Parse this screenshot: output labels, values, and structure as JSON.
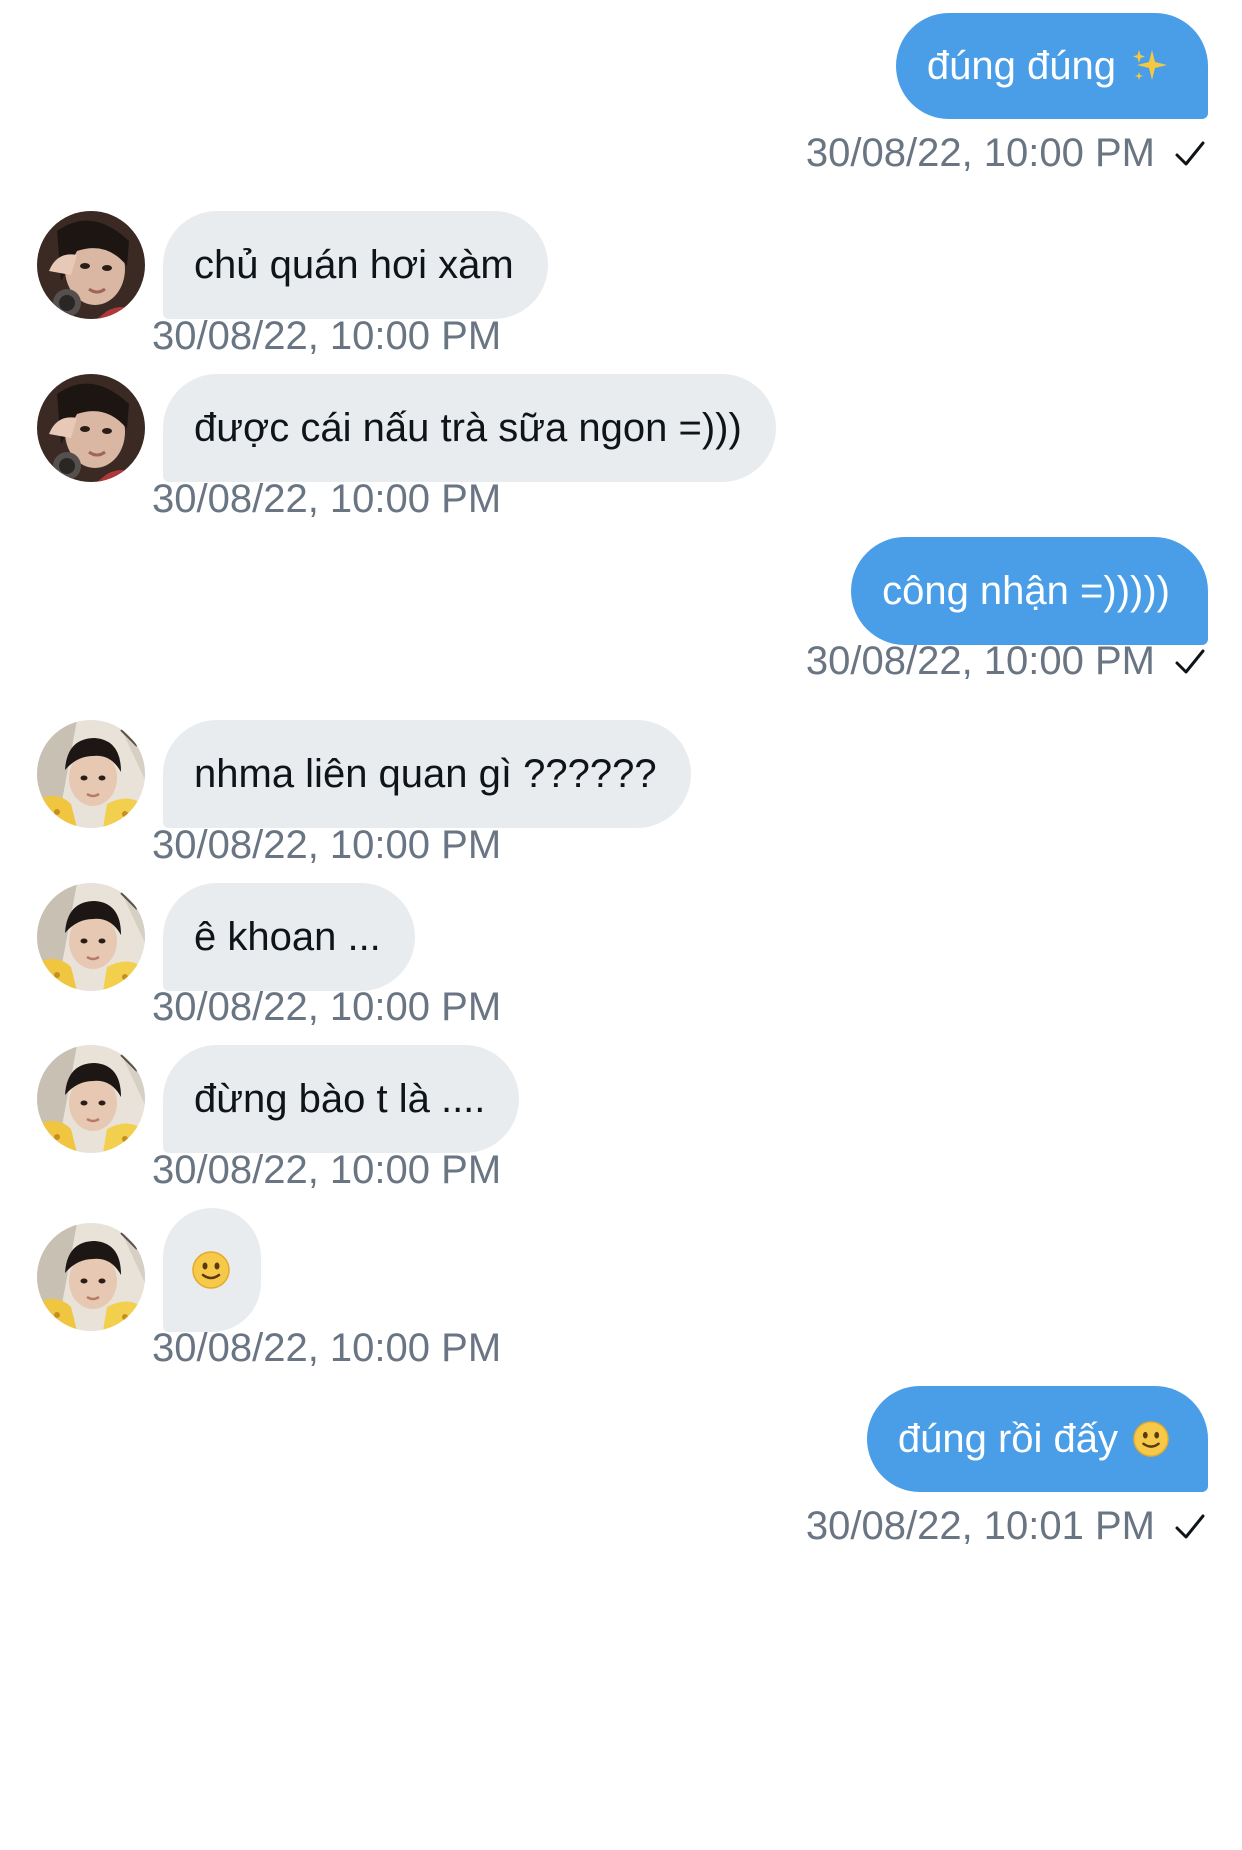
{
  "conversation": {
    "messages": [
      {
        "text": "đúng đúng",
        "time": "30/08/22, 10:00 PM"
      },
      {
        "text": "chủ quán hơi xàm",
        "time": "30/08/22, 10:00 PM"
      },
      {
        "text": "được cái nấu trà sữa ngon =)))",
        "time": "30/08/22, 10:00 PM"
      },
      {
        "text": "công nhận =)))))",
        "time": "30/08/22, 10:00 PM"
      },
      {
        "text": "nhma liên quan gì ??????",
        "time": "30/08/22, 10:00 PM"
      },
      {
        "text": "ê khoan ...",
        "time": "30/08/22, 10:00 PM"
      },
      {
        "text": "đừng bào t là ....",
        "time": "30/08/22, 10:00 PM"
      },
      {
        "text": "",
        "time": "30/08/22, 10:00 PM"
      },
      {
        "text": "đúng rồi đấy",
        "time": "30/08/22, 10:01 PM"
      }
    ]
  },
  "icons": {
    "sent_check": "checkmark-icon",
    "sparkles": "sparkles-emoji",
    "smile": "slightly-smiling-face-emoji"
  },
  "colors": {
    "outgoing_bubble": "#4a9ee8",
    "incoming_bubble": "#e9ecef",
    "timestamp": "#6a7583"
  }
}
